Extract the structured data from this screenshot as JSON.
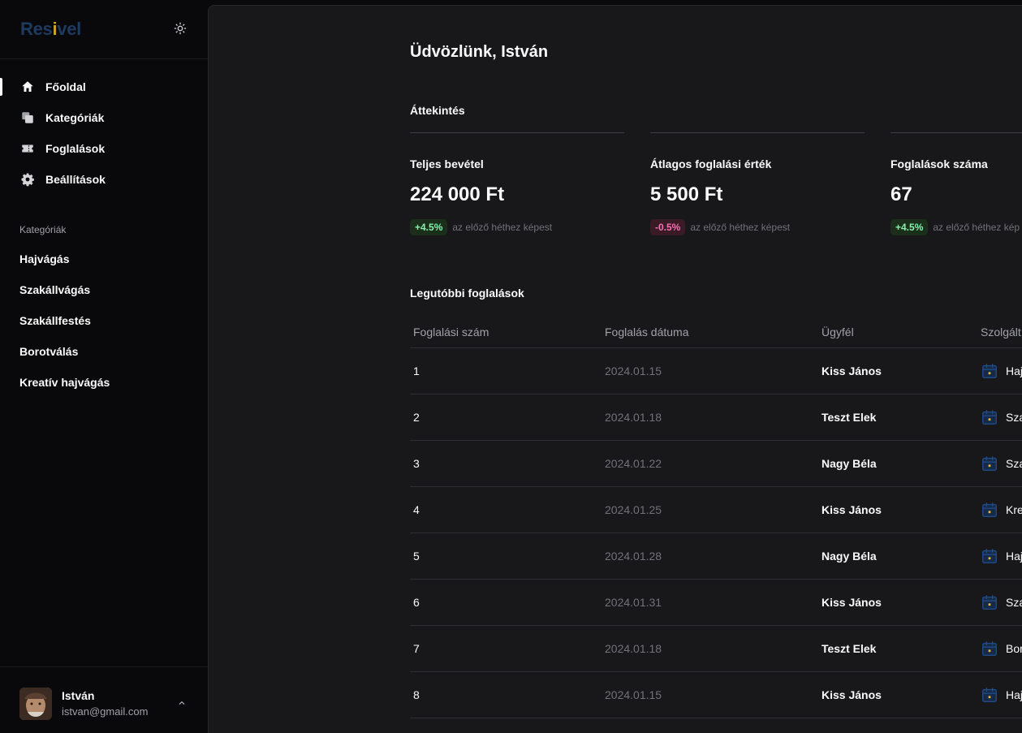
{
  "brand": {
    "logo_text": "Resivel",
    "logo_color": "#1e3a5f",
    "accent_color": "#c9a227"
  },
  "sidebar": {
    "nav": [
      {
        "label": "Főoldal",
        "icon": "home-icon",
        "active": true
      },
      {
        "label": "Kategóriák",
        "icon": "copy-icon",
        "active": false
      },
      {
        "label": "Foglalások",
        "icon": "ticket-icon",
        "active": false
      },
      {
        "label": "Beállítások",
        "icon": "gear-icon",
        "active": false
      }
    ],
    "categories_label": "Kategóriák",
    "categories": [
      "Hajvágás",
      "Szakállvágás",
      "Szakállfestés",
      "Borotválás",
      "Kreatív hajvágás"
    ]
  },
  "user": {
    "name": "István",
    "email": "istvan@gmail.com"
  },
  "main": {
    "greeting": "Üdvözlünk, István",
    "overview_title": "Áttekintés",
    "stats": [
      {
        "label": "Teljes bevétel",
        "value": "224 000 Ft",
        "delta": "+4.5%",
        "trend": "up",
        "compare": "az előző héthez képest"
      },
      {
        "label": "Átlagos foglalási érték",
        "value": "5 500 Ft",
        "delta": "-0.5%",
        "trend": "down",
        "compare": "az előző héthez képest"
      },
      {
        "label": "Foglalások száma",
        "value": "67",
        "delta": "+4.5%",
        "trend": "up",
        "compare": "az előző héthez kép"
      }
    ],
    "recent_title": "Legutóbbi foglalások",
    "table": {
      "columns": [
        "Foglalási szám",
        "Foglalás dátuma",
        "Ügyfél",
        "Szolgált"
      ],
      "rows": [
        {
          "id": "1",
          "date": "2024.01.15",
          "client": "Kiss János",
          "service": "Haj"
        },
        {
          "id": "2",
          "date": "2024.01.18",
          "client": "Teszt Elek",
          "service": "Sza"
        },
        {
          "id": "3",
          "date": "2024.01.22",
          "client": "Nagy Béla",
          "service": "Sza"
        },
        {
          "id": "4",
          "date": "2024.01.25",
          "client": "Kiss János",
          "service": "Kre"
        },
        {
          "id": "5",
          "date": "2024.01.28",
          "client": "Nagy Béla",
          "service": "Haj"
        },
        {
          "id": "6",
          "date": "2024.01.31",
          "client": "Kiss János",
          "service": "Sza"
        },
        {
          "id": "7",
          "date": "2024.01.18",
          "client": "Teszt Elek",
          "service": "Bor"
        },
        {
          "id": "8",
          "date": "2024.01.15",
          "client": "Kiss János",
          "service": "Haj"
        }
      ]
    }
  }
}
